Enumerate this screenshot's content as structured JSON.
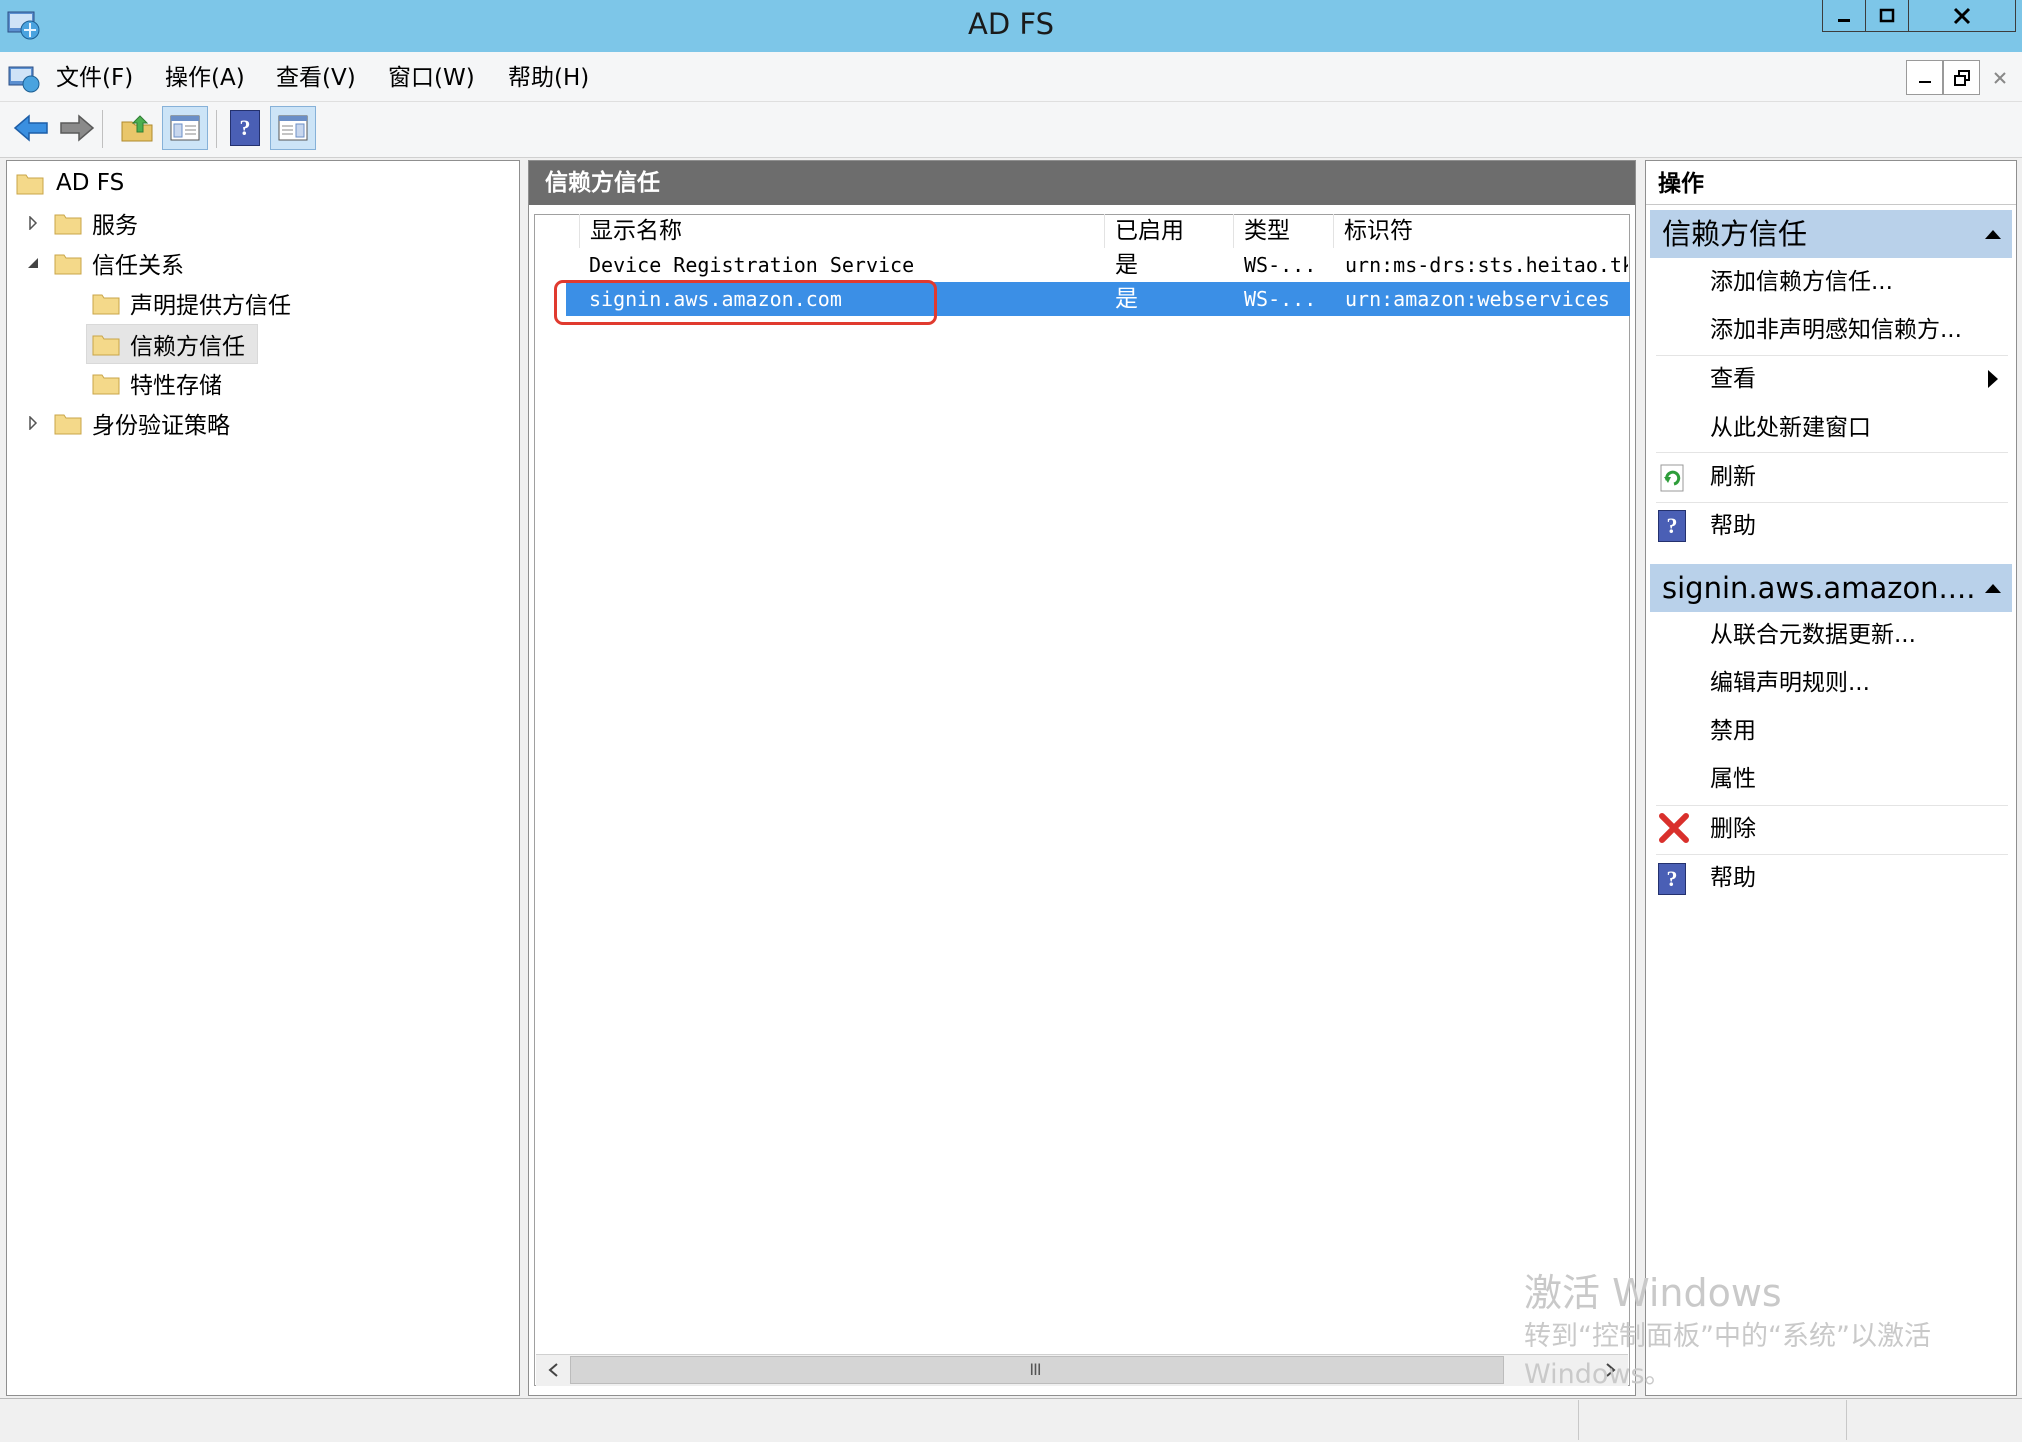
{
  "window": {
    "title": "AD FS"
  },
  "menu": [
    {
      "label": "文件(F)"
    },
    {
      "label": "操作(A)"
    },
    {
      "label": "查看(V)"
    },
    {
      "label": "窗口(W)"
    },
    {
      "label": "帮助(H)"
    }
  ],
  "toolbar": {
    "icons": [
      "back-arrow-icon",
      "forward-arrow-icon",
      "up-folder-icon",
      "show-hide-tree-icon",
      "help-icon",
      "show-hide-action-pane-icon"
    ]
  },
  "tree": {
    "root": "AD FS",
    "items": [
      {
        "label": "服务"
      },
      {
        "label": "信任关系"
      },
      {
        "label": "声明提供方信任"
      },
      {
        "label": "信赖方信任"
      },
      {
        "label": "特性存储"
      },
      {
        "label": "身份验证策略"
      }
    ]
  },
  "center": {
    "title": "信赖方信任",
    "columns": [
      "显示名称",
      "已启用",
      "类型",
      "标识符"
    ],
    "rows": [
      {
        "name": "Device Registration Service",
        "enabled": "是",
        "type": "WS-...",
        "identifier": "urn:ms-drs:sts.heitao.tk"
      },
      {
        "name": "signin.aws.amazon.com",
        "enabled": "是",
        "type": "WS-...",
        "identifier": "urn:amazon:webservices"
      }
    ],
    "scroll_grip": "III"
  },
  "actions": {
    "title": "操作",
    "section1": {
      "title": "信赖方信任",
      "items": [
        "添加信赖方信任...",
        "添加非声明感知信赖方...",
        "查看",
        "从此处新建窗口",
        "刷新",
        "帮助"
      ]
    },
    "section2": {
      "title": "signin.aws.amazon....",
      "items": [
        "从联合元数据更新...",
        "编辑声明规则...",
        "禁用",
        "属性",
        "删除",
        "帮助"
      ]
    }
  },
  "watermark": {
    "title": "激活 Windows",
    "line1": "转到“控制面板”中的“系统”以激活",
    "line2": "Windows。"
  },
  "colors": {
    "titlebar": "#7dc6e8",
    "selection": "#3b8fe6",
    "highlight_box": "#e03a2f",
    "section_header": "#b9d1ea",
    "pane_header": "#6d6d6d"
  }
}
